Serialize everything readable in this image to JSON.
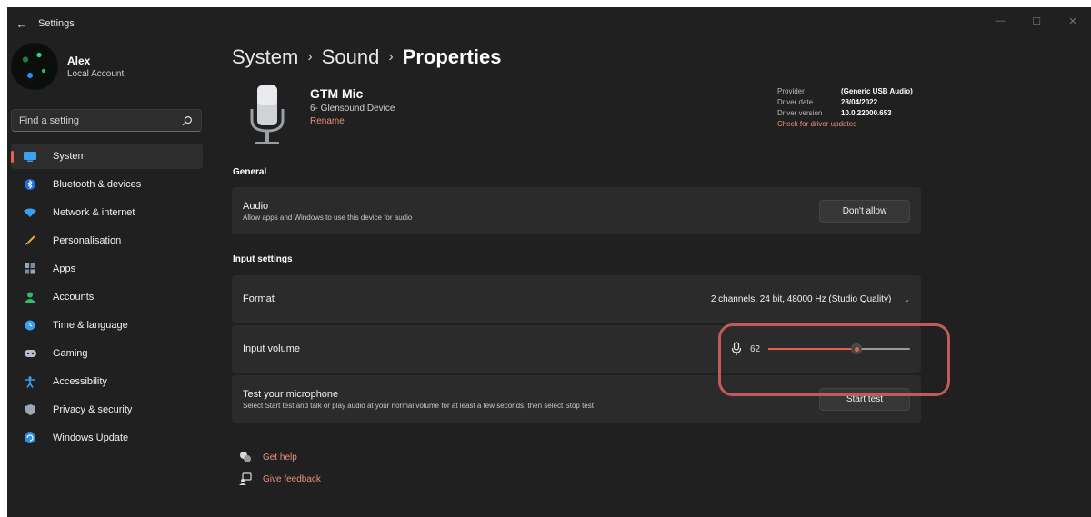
{
  "window": {
    "title": "Settings",
    "back_icon": "back-arrow-icon"
  },
  "profile": {
    "name": "Alex",
    "account_type": "Local Account"
  },
  "search": {
    "placeholder": "Find a setting"
  },
  "sidebar": {
    "items": [
      {
        "label": "System",
        "icon": "system-icon",
        "active": true
      },
      {
        "label": "Bluetooth & devices",
        "icon": "bluetooth-icon"
      },
      {
        "label": "Network & internet",
        "icon": "wifi-icon"
      },
      {
        "label": "Personalisation",
        "icon": "brush-icon"
      },
      {
        "label": "Apps",
        "icon": "apps-icon"
      },
      {
        "label": "Accounts",
        "icon": "person-icon"
      },
      {
        "label": "Time & language",
        "icon": "globe-clock-icon"
      },
      {
        "label": "Gaming",
        "icon": "gamepad-icon"
      },
      {
        "label": "Accessibility",
        "icon": "accessibility-icon"
      },
      {
        "label": "Privacy & security",
        "icon": "shield-icon"
      },
      {
        "label": "Windows Update",
        "icon": "update-icon"
      }
    ]
  },
  "breadcrumb": {
    "level1": "System",
    "level2": "Sound",
    "current": "Properties",
    "separator": "›"
  },
  "device": {
    "name": "GTM Mic",
    "subtitle": "6- Glensound Device",
    "rename_label": "Rename",
    "driver": {
      "provider_label": "Provider",
      "provider": "(Generic USB Audio)",
      "date_label": "Driver date",
      "date": "28/04/2022",
      "version_label": "Driver version",
      "version": "10.0.22000.653",
      "check_updates": "Check for driver updates"
    }
  },
  "general": {
    "heading": "General",
    "audio": {
      "title": "Audio",
      "subtitle": "Allow apps and Windows to use this device for audio",
      "button": "Don't allow"
    }
  },
  "input_settings": {
    "heading": "Input settings",
    "format": {
      "title": "Format",
      "value": "2 channels, 24 bit, 48000 Hz (Studio Quality)"
    },
    "volume": {
      "title": "Input volume",
      "value": "62",
      "level": 0.62
    },
    "test": {
      "title": "Test your microphone",
      "subtitle": "Select Start test and talk or play audio at your normal volume for at least a few seconds, then select Stop test",
      "button": "Start test"
    }
  },
  "help": {
    "get_help": "Get help",
    "give_feedback": "Give feedback"
  },
  "colors": {
    "accent": "#e8614e",
    "link": "#e8917f",
    "background": "#202020",
    "card": "#2b2b2b",
    "highlight": "#c25a57"
  }
}
